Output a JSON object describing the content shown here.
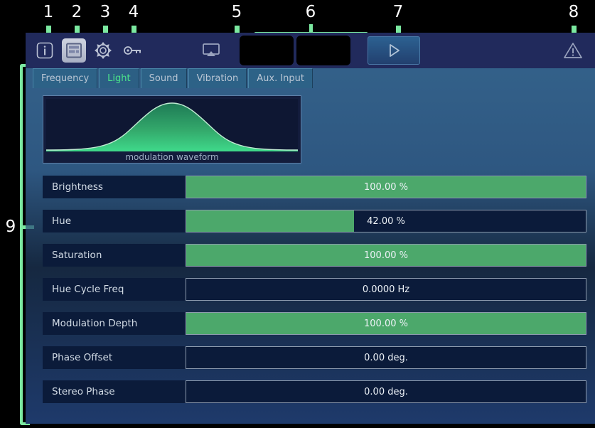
{
  "callouts": [
    {
      "id": "1",
      "label": "info-button"
    },
    {
      "id": "2",
      "label": "layout-button"
    },
    {
      "id": "3",
      "label": "settings-button"
    },
    {
      "id": "4",
      "label": "license-button"
    },
    {
      "id": "5",
      "label": "cast-button"
    },
    {
      "id": "6",
      "label": "readout-displays"
    },
    {
      "id": "7",
      "label": "play-button"
    },
    {
      "id": "8",
      "label": "warning-indicator"
    },
    {
      "id": "9",
      "label": "parameter-panel"
    }
  ],
  "toolbar": {
    "icons": [
      {
        "name": "info-icon",
        "active": false
      },
      {
        "name": "layout-panel-icon",
        "active": true
      },
      {
        "name": "gear-icon",
        "active": false
      },
      {
        "name": "key-icon",
        "active": false
      },
      {
        "name": "airplay-cast-icon",
        "active": false
      }
    ],
    "readouts": [
      "",
      ""
    ],
    "play_icon": "play-triangle-icon",
    "warning_icon": "warning-triangle-icon"
  },
  "tabs": [
    {
      "label": "Frequency",
      "active": false
    },
    {
      "label": "Light",
      "active": true
    },
    {
      "label": "Sound",
      "active": false
    },
    {
      "label": "Vibration",
      "active": false
    },
    {
      "label": "Aux. Input",
      "active": false
    }
  ],
  "waveform": {
    "caption": "modulation waveform"
  },
  "parameters": [
    {
      "label": "Brightness",
      "value": "100.00 %",
      "fill": 100
    },
    {
      "label": "Hue",
      "value": "42.00 %",
      "fill": 42
    },
    {
      "label": "Saturation",
      "value": "100.00 %",
      "fill": 100
    },
    {
      "label": "Hue Cycle Freq",
      "value": "0.0000 Hz",
      "fill": 0
    },
    {
      "label": "Modulation Depth",
      "value": "100.00 %",
      "fill": 100
    },
    {
      "label": "Phase Offset",
      "value": "0.00 deg.",
      "fill": 0
    },
    {
      "label": "Stereo Phase",
      "value": "0.00 deg.",
      "fill": 0
    }
  ],
  "colors": {
    "accent_green": "#4CA86B",
    "callout_green": "#7BE8A0",
    "active_tab_text": "#4BE38A",
    "panel_dark": "#0B1B3A",
    "toolbar_bg": "#212A5C"
  }
}
